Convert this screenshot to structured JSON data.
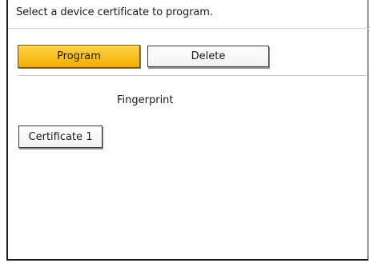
{
  "header": {
    "instruction": "Select a device certificate to program."
  },
  "actions": {
    "program_label": "Program",
    "delete_label": "Delete"
  },
  "list": {
    "column_header": "Fingerprint",
    "items": [
      {
        "label": "Certificate 1"
      }
    ]
  },
  "colors": {
    "selected_button": "#F7B500",
    "frame_border": "#1A1A1A"
  }
}
